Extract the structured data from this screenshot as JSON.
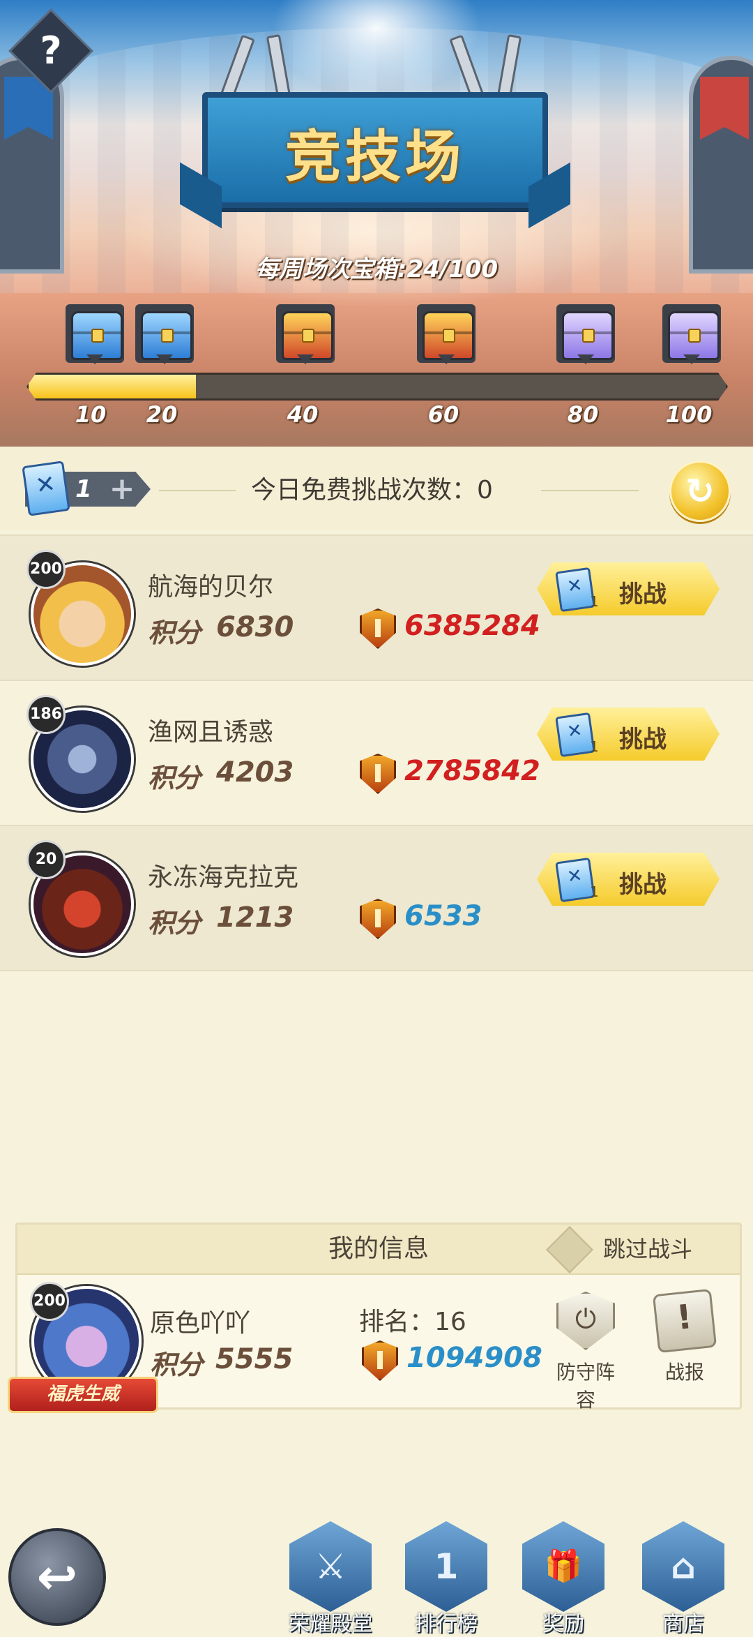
{
  "header": {
    "help_label": "?",
    "title": "竞技场",
    "weekly_chest": "每周场次宝箱:24/100",
    "weekly_progress": 0.24
  },
  "chests": [
    {
      "tier": "blue",
      "label": "10"
    },
    {
      "tier": "blue",
      "label": "20"
    },
    {
      "tier": "red",
      "label": "40"
    },
    {
      "tier": "red",
      "label": "60"
    },
    {
      "tier": "purple",
      "label": "80"
    },
    {
      "tier": "purple",
      "label": "100"
    }
  ],
  "challenge_bar": {
    "ticket_count": "1",
    "plus": "+",
    "free_today": "今日免费挑战次数：0",
    "refresh_icon": "refresh-icon"
  },
  "opponents": [
    {
      "level": "200",
      "name": "航海的贝尔",
      "score_label": "积分",
      "score": "6830",
      "power": "6385284",
      "power_color": "#d21f1f",
      "ticket_cost": "1",
      "button": "挑战"
    },
    {
      "level": "186",
      "name": "渔网且诱惑",
      "score_label": "积分",
      "score": "4203",
      "power": "2785842",
      "power_color": "#d21f1f",
      "ticket_cost": "1",
      "button": "挑战"
    },
    {
      "level": "20",
      "name": "永冻海克拉克",
      "score_label": "积分",
      "score": "1213",
      "power": "6533",
      "power_color": "#2a8fc8",
      "ticket_cost": "1",
      "button": "挑战"
    }
  ],
  "my_info": {
    "title": "我的信息",
    "skip_battle": "跳过战斗",
    "level": "200",
    "badge": "福虎生威",
    "name": "原色吖吖",
    "rank": "排名：16",
    "score_label": "积分",
    "score": "5555",
    "power": "1094908",
    "defense": "防守阵容",
    "report": "战报"
  },
  "bottom_nav": {
    "back_icon": "back-arrow-icon",
    "items": [
      "荣耀殿堂",
      "排行榜",
      "奖励",
      "商店"
    ]
  },
  "colors": {
    "accent_yellow": "#f5cb2c",
    "power_red": "#d21f1f",
    "power_blue": "#2a8fc8",
    "panel_bg": "#f6f2dc"
  }
}
